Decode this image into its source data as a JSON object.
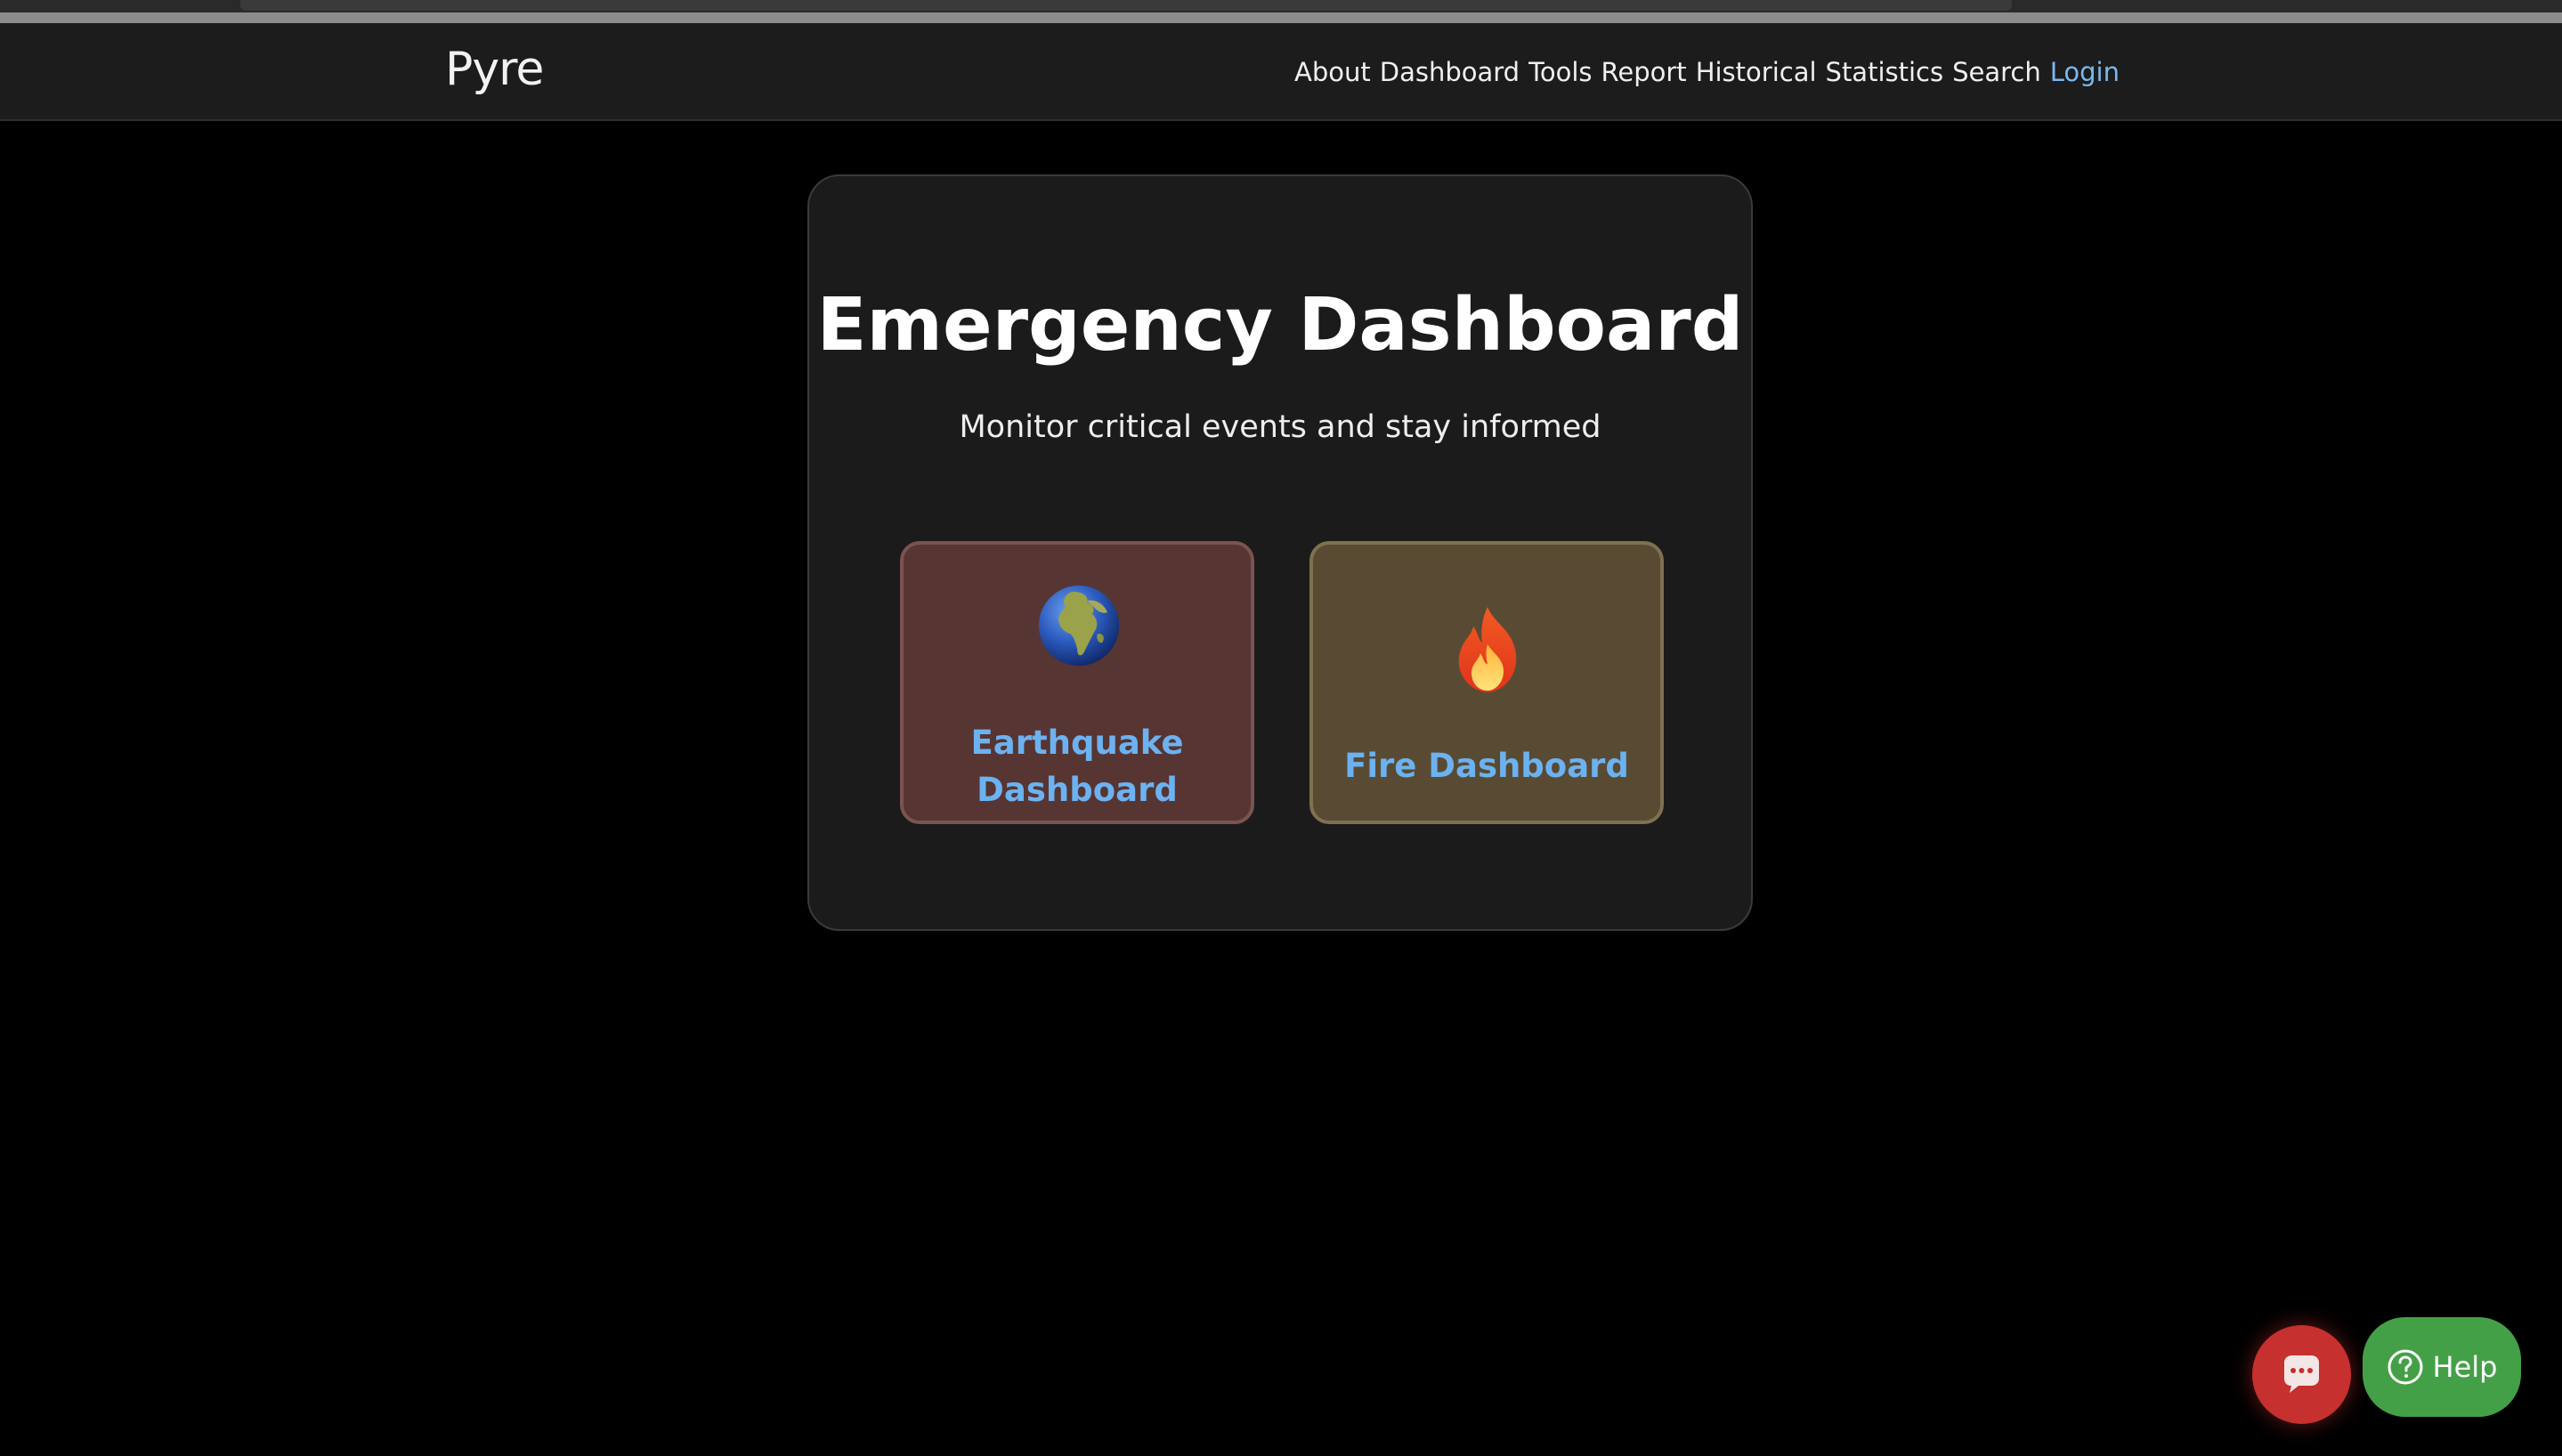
{
  "navbar": {
    "brand": "Pyre",
    "links": [
      "About",
      "Dashboard",
      "Tools",
      "Report",
      "Historical",
      "Statistics",
      "Search"
    ],
    "login": "Login"
  },
  "main": {
    "title": "Emergency Dashboard",
    "subtitle": "Monitor critical events and stay informed",
    "cards": [
      {
        "icon": "globe-icon",
        "label_line1": "Earthquake",
        "label_line2": "Dashboard"
      },
      {
        "icon": "fire-icon",
        "label": "Fire Dashboard"
      }
    ]
  },
  "floating": {
    "chat_icon": "chat-bubble-icon",
    "help_label": "Help",
    "help_icon": "question-circle-icon"
  },
  "colors": {
    "background": "#000000",
    "navbar": "#1c1c1c",
    "panel": "#1b1b1b",
    "card_earthquake": "#573533",
    "card_fire": "#594b33",
    "card_label": "#6cb2f0",
    "login_link": "#79b8f0",
    "chat_button": "#c6302e",
    "help_button": "#44a047"
  }
}
